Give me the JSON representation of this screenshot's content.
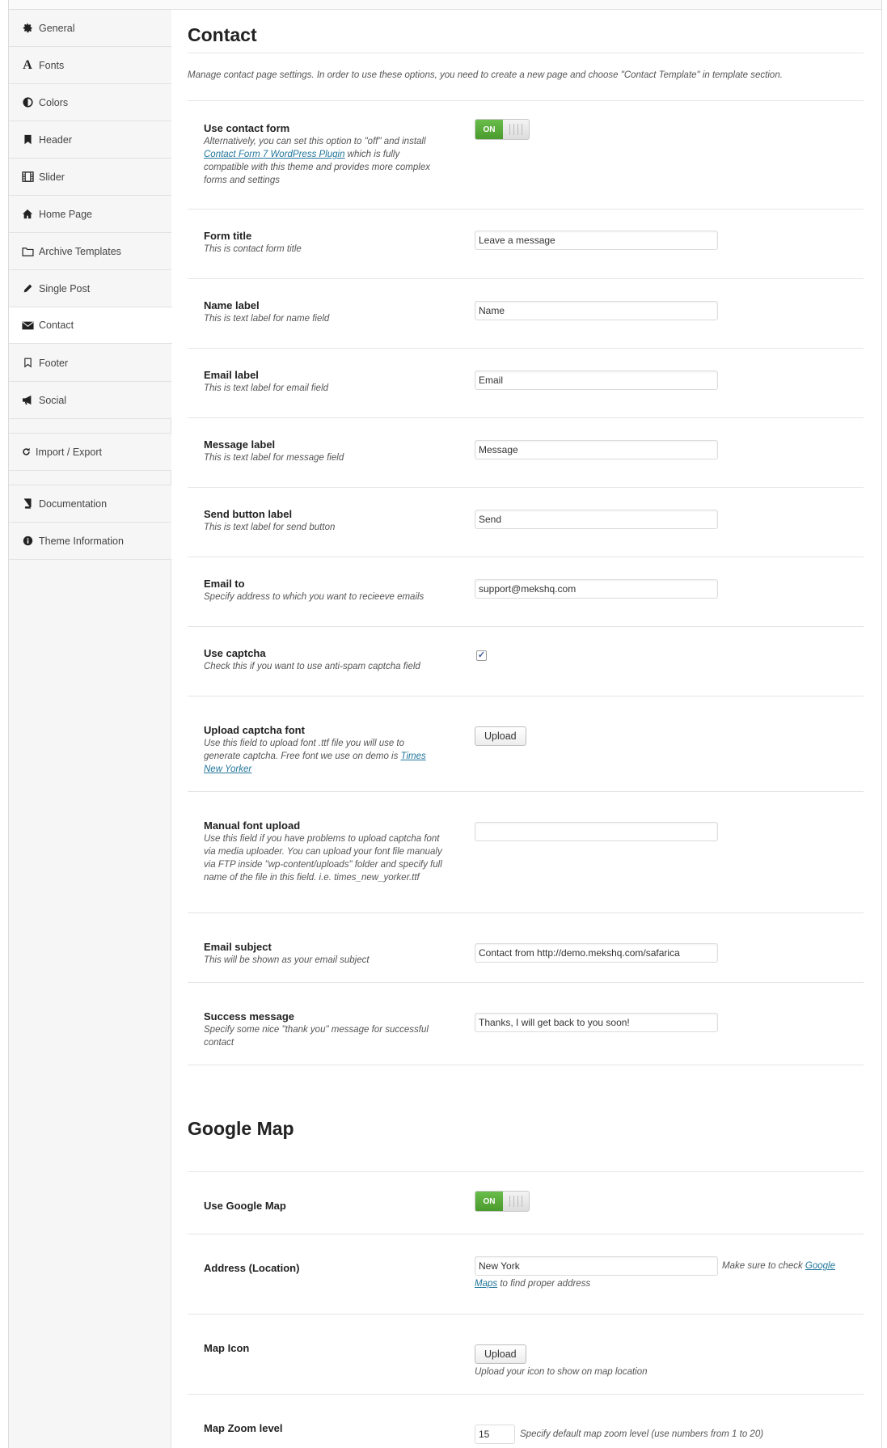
{
  "sidebar": {
    "items": [
      {
        "label": "General",
        "icon": "gear-icon"
      },
      {
        "label": "Fonts",
        "icon": "font-icon"
      },
      {
        "label": "Colors",
        "icon": "contrast-icon"
      },
      {
        "label": "Header",
        "icon": "bookmark-icon"
      },
      {
        "label": "Slider",
        "icon": "film-icon"
      },
      {
        "label": "Home Page",
        "icon": "home-icon"
      },
      {
        "label": "Archive Templates",
        "icon": "folder-icon"
      },
      {
        "label": "Single Post",
        "icon": "pencil-icon"
      },
      {
        "label": "Contact",
        "icon": "envelope-icon",
        "active": true
      },
      {
        "label": "Footer",
        "icon": "bookmark-outline-icon"
      },
      {
        "label": "Social",
        "icon": "megaphone-icon"
      },
      {
        "label": "Import / Export",
        "icon": "refresh-icon"
      },
      {
        "label": "Documentation",
        "icon": "book-icon"
      },
      {
        "label": "Theme Information",
        "icon": "info-icon"
      }
    ]
  },
  "contact": {
    "title": "Contact",
    "intro": "Manage contact page settings. In order to use these options, you need to create a new page and choose \"Contact Template\" in template section.",
    "use_form": {
      "label": "Use contact form",
      "desc_before": "Alternatively, you can set this option to \"off\" and install ",
      "desc_link": "Contact Form 7 WordPress Plugin",
      "desc_after": " which is fully compatible with this theme and provides more complex forms and settings",
      "toggle": "ON"
    },
    "form_title": {
      "label": "Form title",
      "desc": "This is contact form title",
      "value": "Leave a message"
    },
    "name_label": {
      "label": "Name label",
      "desc": "This is text label for name field",
      "value": "Name"
    },
    "email_label": {
      "label": "Email label",
      "desc": "This is text label for email field",
      "value": "Email"
    },
    "message_label": {
      "label": "Message label",
      "desc": "This is text label for message field",
      "value": "Message"
    },
    "send_label": {
      "label": "Send button label",
      "desc": "This is text label for send button",
      "value": "Send"
    },
    "email_to": {
      "label": "Email to",
      "desc": "Specify address to which you want to recieeve emails",
      "value": "support@mekshq.com"
    },
    "captcha": {
      "label": "Use captcha",
      "desc": "Check this if you want to use anti-spam captcha field",
      "checked": true,
      "check_glyph": "✓"
    },
    "captcha_font": {
      "label": "Upload captcha font",
      "desc_before": "Use this field to upload font .ttf file you will use to generate captcha. Free font we use on demo is ",
      "desc_link": "Times New Yorker",
      "button": "Upload"
    },
    "manual_font": {
      "label": "Manual font upload",
      "desc": "Use this field if you have problems to upload captcha font via media uploader. You can upload your font file manualy via FTP inside \"wp-content/uploads\" folder and specify full name of the file in this field. i.e. times_new_yorker.ttf",
      "value": ""
    },
    "email_subject": {
      "label": "Email subject",
      "desc": "This will be shown as your email subject",
      "value": "Contact from http://demo.mekshq.com/safarica"
    },
    "success": {
      "label": "Success message",
      "desc": "Specify some nice \"thank you\" message for successful contact",
      "value": "Thanks, I will get back to you soon!"
    }
  },
  "map": {
    "title": "Google Map",
    "use_map": {
      "label": "Use Google Map",
      "toggle": "ON"
    },
    "address": {
      "label": "Address (Location)",
      "value": "New York",
      "note_before": "Make sure to check ",
      "note_link_1": "Google",
      "note_link_2": "Maps",
      "note_after": " to find proper address"
    },
    "icon": {
      "label": "Map Icon",
      "button": "Upload",
      "note": "Upload your icon to show on map location"
    },
    "zoom": {
      "label": "Map Zoom level",
      "value": "15",
      "note": "Specify default map zoom level (use numbers from 1 to 20)"
    }
  }
}
